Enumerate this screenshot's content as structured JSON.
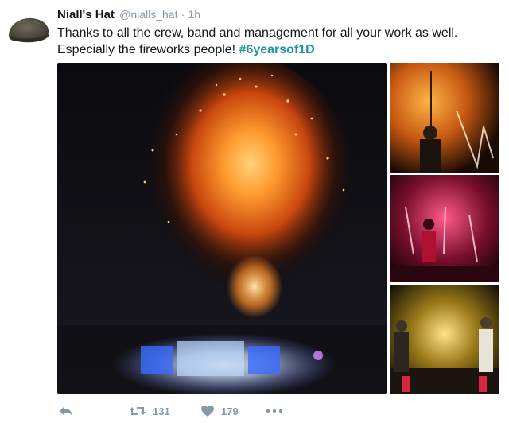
{
  "tweet": {
    "author_name": "Niall's Hat",
    "author_handle": "@nialls_hat",
    "separator": "·",
    "time": "1h",
    "text_line1": "Thanks to all the crew, band and management for all your work as well.",
    "text_line2_prefix": "Especially the fireworks people!",
    "hashtag": "#6yearsof1D",
    "avatar_icon": "flat-cap-hat",
    "photo_count": 4
  },
  "actions": {
    "reply_icon": "reply-arrow-icon",
    "retweet_icon": "retweet-icon",
    "retweet_count": "131",
    "like_icon": "heart-icon",
    "like_count": "179",
    "more_icon": "more-dots-icon"
  },
  "colors": {
    "name": "#14171a",
    "meta": "#8899a6",
    "hashtag": "#1b95a0",
    "firework": "#ff7a1a"
  }
}
